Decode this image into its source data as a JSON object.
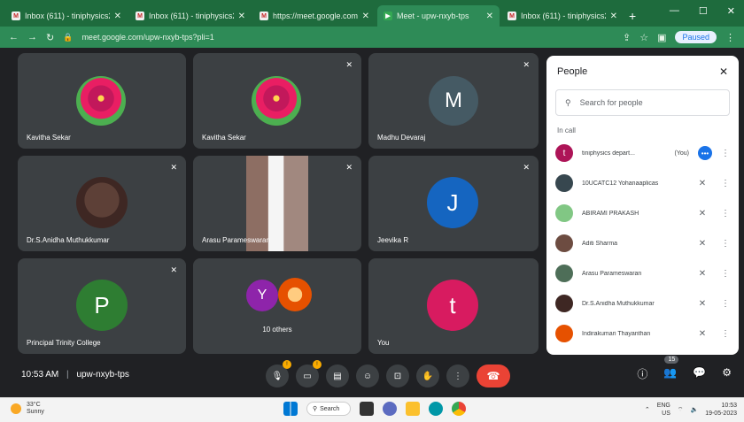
{
  "browser": {
    "tabs": [
      {
        "title": "Inbox (611) - tiniphysics22...",
        "active": false
      },
      {
        "title": "Inbox (611) - tiniphysics22...",
        "active": false
      },
      {
        "title": "https://meet.google.com/u...",
        "active": false
      },
      {
        "title": "Meet - upw-nxyb-tps",
        "active": true
      },
      {
        "title": "Inbox (611) - tiniphysics22...",
        "active": false
      }
    ],
    "new_tab": "+",
    "url": "meet.google.com/upw-nxyb-tps?pli=1",
    "paused_label": "Paused"
  },
  "tiles": [
    {
      "name": "Kavitha Sekar",
      "kind": "flower"
    },
    {
      "name": "Kavitha Sekar",
      "kind": "flower"
    },
    {
      "name": "Madhu Devaraj",
      "kind": "letter",
      "letter": "M",
      "color": "#455a64"
    },
    {
      "name": "Dr.S.Anidha Muthukkumar",
      "kind": "face"
    },
    {
      "name": "Arasu Parameswaran",
      "kind": "room"
    },
    {
      "name": "Jeevika R",
      "kind": "letter",
      "letter": "J",
      "color": "#1565c0"
    },
    {
      "name": "Principal Trinity College",
      "kind": "letter",
      "letter": "P",
      "color": "#2e7d32"
    },
    {
      "name": "10 others",
      "kind": "others",
      "letter": "Y",
      "color": "#8e24aa"
    },
    {
      "name": "You",
      "kind": "letter",
      "letter": "t",
      "color": "#d81b60"
    }
  ],
  "people_panel": {
    "title": "People",
    "search_placeholder": "Search for people",
    "section": "In call",
    "you_tag": "(You)",
    "people": [
      {
        "name": "tiniphysics depart...",
        "color": "#ad1457",
        "letter": "t"
      },
      {
        "name": "10UCATC12 Yohanaaplicas",
        "color": "#37474f",
        "letter": ""
      },
      {
        "name": "ABIRAMI PRAKASH",
        "color": "#81c784",
        "letter": ""
      },
      {
        "name": "Aditi Sharma",
        "color": "#6d4c41",
        "letter": ""
      },
      {
        "name": "Arasu Parameswaran",
        "color": "#4e6e58",
        "letter": ""
      },
      {
        "name": "Dr.S.Anidha Muthukkumar",
        "color": "#3e2723",
        "letter": ""
      },
      {
        "name": "Indirakumari Thayanthan",
        "color": "#e65100",
        "letter": ""
      }
    ]
  },
  "bottom_bar": {
    "time": "10:53 AM",
    "separator": "|",
    "meeting_code": "upw-nxyb-tps",
    "participant_count": "15"
  },
  "taskbar": {
    "temp": "33°C",
    "condition": "Sunny",
    "search": "Search",
    "lang": "ENG",
    "region": "US",
    "clock": "10:53",
    "date": "19-05-2023"
  }
}
